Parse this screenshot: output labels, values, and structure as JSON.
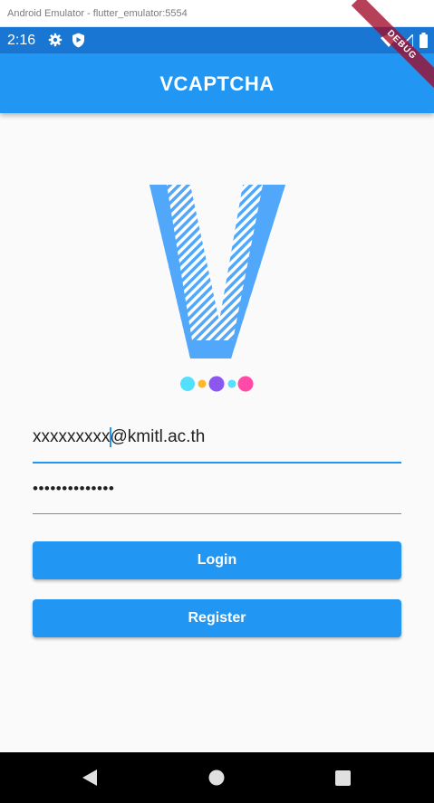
{
  "window": {
    "title": "Android Emulator - flutter_emulator:5554"
  },
  "status_bar": {
    "time": "2:16",
    "icons": [
      "gear-icon",
      "shield-icon",
      "wifi-icon",
      "signal-icon",
      "battery-icon"
    ]
  },
  "app_bar": {
    "title": "VCAPTCHA",
    "debug_banner": "DEBUG"
  },
  "logo": {
    "dots": [
      "#53e0ff",
      "#ffb627",
      "#8b57ee",
      "#53e0ff",
      "#ff4aa7"
    ]
  },
  "form": {
    "email_value": "xxxxxxxxx@kmitl.ac.th",
    "password_value": "••••••••••••••"
  },
  "buttons": {
    "login": "Login",
    "register": "Register"
  },
  "colors": {
    "status_bar": "#1976d2",
    "app_bar": "#2196f3",
    "accent": "#2196f3",
    "logo": "#51a7f9",
    "background": "#fafafa"
  },
  "nav": {
    "icons": [
      "back-icon",
      "home-icon",
      "recents-icon"
    ]
  }
}
